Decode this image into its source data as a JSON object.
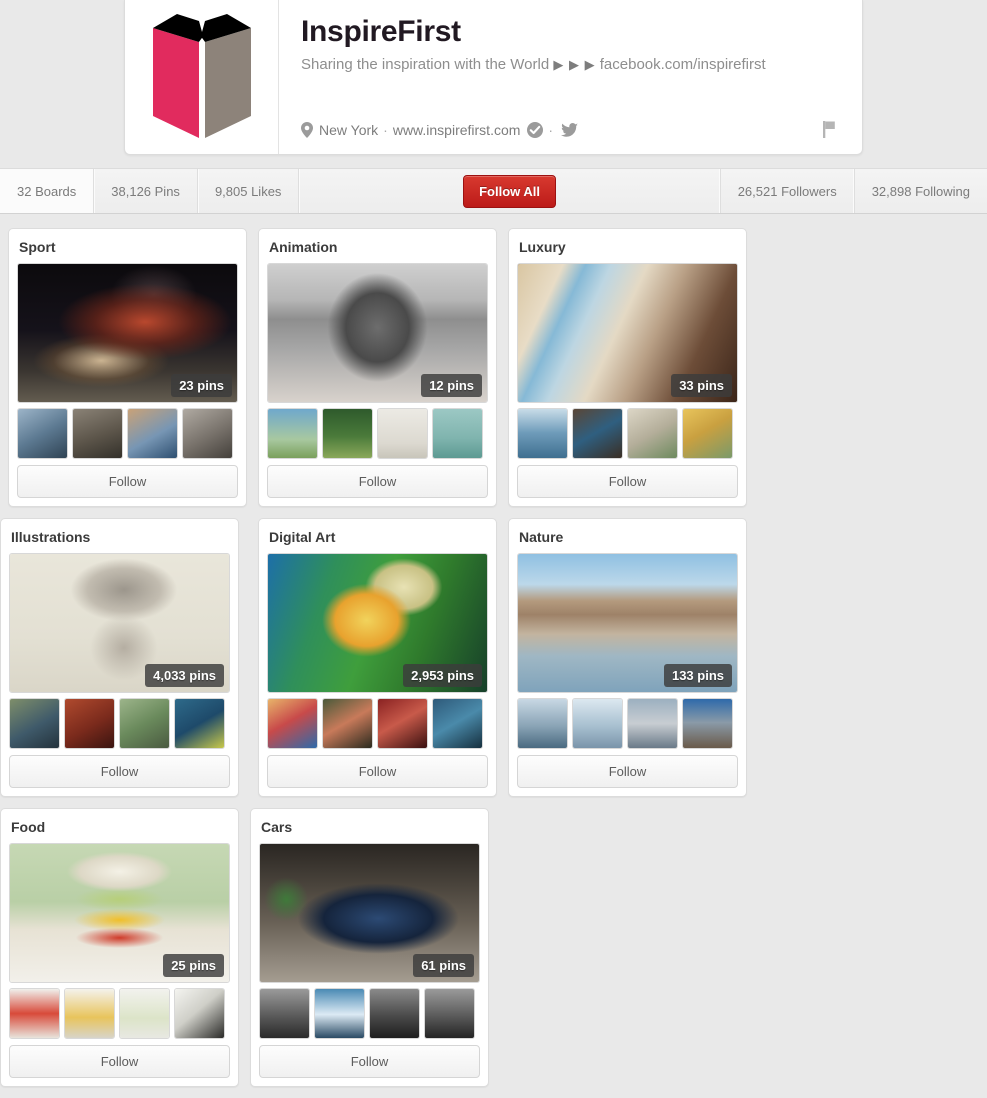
{
  "profile": {
    "name": "InspireFirst",
    "tagline_before": "Sharing the inspiration with the World",
    "tagline_arrows": "▶ ▶ ▶",
    "tagline_after": "facebook.com/inspirefirst",
    "location": "New York",
    "separator": "·",
    "website": "www.inspirefirst.com",
    "logo_icon": "open-book-logo",
    "location_icon": "map-pin-icon",
    "verified_icon": "verified-check-icon",
    "twitter_icon": "twitter-bird-icon",
    "report_icon": "flag-icon",
    "logo_colors": {
      "left_page": "#e12b5e",
      "right_page": "#8d837a",
      "top": "#000000"
    }
  },
  "stats": {
    "boards": "32 Boards",
    "pins": "38,126 Pins",
    "likes": "9,805 Likes",
    "follow_all": "Follow All",
    "followers": "26,521 Followers",
    "following": "32,898 Following",
    "follow_all_color": "#c4201e"
  },
  "boards": [
    {
      "title": "Sport",
      "pins": "23 pins",
      "cover_class": "ph-sport",
      "cover_name": "board-cover-sport",
      "follow_label": "Follow",
      "thumbs": [
        {
          "class": "t-grayblue",
          "name": "thumb-sport-1"
        },
        {
          "class": "t-dimroom",
          "name": "thumb-sport-2"
        },
        {
          "class": "t-bluetrk",
          "name": "thumb-sport-3"
        },
        {
          "class": "t-graygym",
          "name": "thumb-sport-4"
        }
      ]
    },
    {
      "title": "Animation",
      "pins": "12 pins",
      "cover_class": "ph-anim",
      "cover_name": "board-cover-animation",
      "follow_label": "Follow",
      "thumbs": [
        {
          "class": "t-animblue",
          "name": "thumb-animation-1"
        },
        {
          "class": "t-animgrn",
          "name": "thumb-animation-2"
        },
        {
          "class": "t-animwht",
          "name": "thumb-animation-3"
        },
        {
          "class": "t-animteal",
          "name": "thumb-animation-4"
        }
      ]
    },
    {
      "title": "Luxury",
      "pins": "33 pins",
      "cover_class": "ph-lux",
      "cover_name": "board-cover-luxury",
      "follow_label": "Follow",
      "thumbs": [
        {
          "class": "t-sea",
          "name": "thumb-luxury-1"
        },
        {
          "class": "t-darkroom",
          "name": "thumb-luxury-2"
        },
        {
          "class": "t-patio",
          "name": "thumb-luxury-3"
        },
        {
          "class": "t-pergola",
          "name": "thumb-luxury-4"
        }
      ]
    },
    {
      "title": "Illustrations",
      "pins": "4,033 pins",
      "cover_class": "ph-illus",
      "cover_name": "board-cover-illustrations",
      "follow_label": "Follow",
      "thumbs": [
        {
          "class": "t-ill1",
          "name": "thumb-illustrations-1"
        },
        {
          "class": "t-ill2",
          "name": "thumb-illustrations-2"
        },
        {
          "class": "t-ill3",
          "name": "thumb-illustrations-3"
        },
        {
          "class": "t-ill4",
          "name": "thumb-illustrations-4"
        }
      ]
    },
    {
      "title": "Digital Art",
      "pins": "2,953 pins",
      "cover_class": "ph-digital",
      "cover_name": "board-cover-digital-art",
      "follow_label": "Follow",
      "thumbs": [
        {
          "class": "t-da1",
          "name": "thumb-digital-art-1"
        },
        {
          "class": "t-da2",
          "name": "thumb-digital-art-2"
        },
        {
          "class": "t-da3",
          "name": "thumb-digital-art-3"
        },
        {
          "class": "t-da4",
          "name": "thumb-digital-art-4"
        }
      ]
    },
    {
      "title": "Nature",
      "pins": "133 pins",
      "cover_class": "ph-nature",
      "cover_name": "board-cover-nature",
      "follow_label": "Follow",
      "thumbs": [
        {
          "class": "t-ice1",
          "name": "thumb-nature-1"
        },
        {
          "class": "t-ice2",
          "name": "thumb-nature-2"
        },
        {
          "class": "t-ice3",
          "name": "thumb-nature-3"
        },
        {
          "class": "t-ice4",
          "name": "thumb-nature-4"
        }
      ]
    },
    {
      "title": "Food",
      "pins": "25 pins",
      "cover_class": "ph-food",
      "cover_name": "board-cover-food",
      "follow_label": "Follow",
      "thumbs": [
        {
          "class": "t-food1",
          "name": "thumb-food-1"
        },
        {
          "class": "t-food2",
          "name": "thumb-food-2"
        },
        {
          "class": "t-food3",
          "name": "thumb-food-3"
        },
        {
          "class": "t-food4",
          "name": "thumb-food-4"
        }
      ]
    },
    {
      "title": "Cars",
      "pins": "61 pins",
      "cover_class": "ph-cars",
      "cover_name": "board-cover-cars",
      "follow_label": "Follow",
      "thumbs": [
        {
          "class": "t-car1",
          "name": "thumb-cars-1"
        },
        {
          "class": "t-car2",
          "name": "thumb-cars-2"
        },
        {
          "class": "t-car3",
          "name": "thumb-cars-3"
        },
        {
          "class": "t-car4",
          "name": "thumb-cars-4"
        }
      ]
    }
  ]
}
